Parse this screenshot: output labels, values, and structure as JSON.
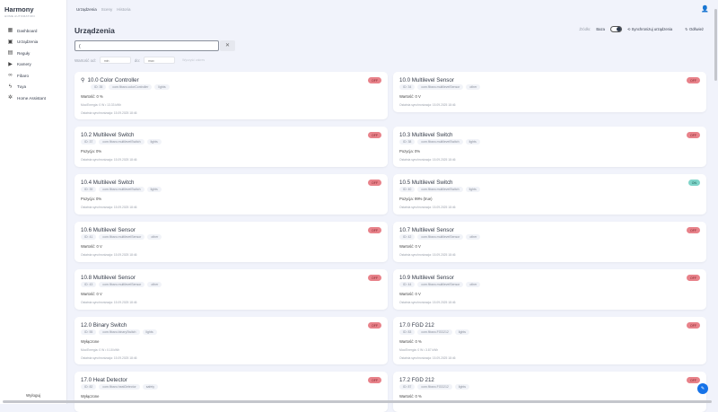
{
  "app": {
    "title": "Harmony",
    "subtitle": "HOME AUTOMATION",
    "logout": "Wyloguj"
  },
  "sidebar": {
    "items": [
      {
        "label": "Dashboard",
        "icon": "▦"
      },
      {
        "label": "Urządzenia",
        "icon": "▣"
      },
      {
        "label": "Reguły",
        "icon": "▤"
      },
      {
        "label": "Kamery",
        "icon": "▶"
      },
      {
        "label": "Fibaro",
        "icon": "∞"
      },
      {
        "label": "Tuya",
        "icon": "ϟ"
      },
      {
        "label": "Home Assistant",
        "icon": "✲"
      }
    ]
  },
  "topnav": {
    "tabs": [
      "Urządzenia",
      "Sceny",
      "Historia"
    ],
    "user_icon": "👤"
  },
  "page": {
    "title": "Urządzenia",
    "search_value": "(",
    "clear": "✕"
  },
  "filter": {
    "from_label": "Wartość od:",
    "min_placeholder": "min",
    "to_label": "do:",
    "max_placeholder": "max",
    "reset": "Wyczyść zakres"
  },
  "toolbar": {
    "source_label": "Źródło:",
    "source_value": "Baza",
    "sync": "Synchronizuj urządzenia",
    "sync_icon": "⟲",
    "refresh": "Odśwież",
    "refresh_icon": "↻"
  },
  "devices": [
    {
      "name": "10.0 Color Controller",
      "id": "ID: 35",
      "type": "com.fibaro.colorController",
      "cat": "lights",
      "value": "Wartość: 0 %",
      "energy": "Moc/Energia: 0 W • 13.33 kWh",
      "sync": "Ostatnia synchronizacja: 15.09.2025 18:46",
      "status": "OFF",
      "icon": true
    },
    {
      "name": "10.0 Multilevel Sensor",
      "id": "ID: 34",
      "type": "com.fibaro.multilevelSensor",
      "cat": "other",
      "value": "Wartość: 0 V",
      "sync": "Ostatnia synchronizacja: 15.09.2025 18:46",
      "status": "OFF"
    },
    {
      "name": "10.2 Multilevel Switch",
      "id": "ID: 37",
      "type": "com.fibaro.multilevelSwitch",
      "cat": "lights",
      "value": "Pozycja: 0%",
      "sync": "Ostatnia synchronizacja: 15.09.2025 18:46",
      "status": "OFF"
    },
    {
      "name": "10.3 Multilevel Switch",
      "id": "ID: 38",
      "type": "com.fibaro.multilevelSwitch",
      "cat": "lights",
      "value": "Pozycja: 0%",
      "sync": "Ostatnia synchronizacja: 15.09.2025 18:46",
      "status": "OFF"
    },
    {
      "name": "10.4 Multilevel Switch",
      "id": "ID: 39",
      "type": "com.fibaro.multilevelSwitch",
      "cat": "lights",
      "value": "Pozycja: 0%",
      "sync": "Ostatnia synchronizacja: 15.09.2025 18:46",
      "status": "OFF"
    },
    {
      "name": "10.5 Multilevel Switch",
      "id": "ID: 40",
      "type": "com.fibaro.multilevelSwitch",
      "cat": "lights",
      "value": "Pozycja: 99% (true)",
      "sync": "Ostatnia synchronizacja: 15.09.2025 18:46",
      "status": "ON"
    },
    {
      "name": "10.6 Multilevel Sensor",
      "id": "ID: 41",
      "type": "com.fibaro.multilevelSensor",
      "cat": "other",
      "value": "Wartość: 0 V",
      "sync": "Ostatnia synchronizacja: 15.09.2025 18:46",
      "status": "OFF"
    },
    {
      "name": "10.7 Multilevel Sensor",
      "id": "ID: 42",
      "type": "com.fibaro.multilevelSensor",
      "cat": "other",
      "value": "Wartość: 0 V",
      "sync": "Ostatnia synchronizacja: 15.09.2025 18:46",
      "status": "OFF"
    },
    {
      "name": "10.8 Multilevel Sensor",
      "id": "ID: 43",
      "type": "com.fibaro.multilevelSensor",
      "cat": "other",
      "value": "Wartość: 0 V",
      "sync": "Ostatnia synchronizacja: 15.09.2025 18:46",
      "status": "OFF"
    },
    {
      "name": "10.9 Multilevel Sensor",
      "id": "ID: 44",
      "type": "com.fibaro.multilevelSensor",
      "cat": "other",
      "value": "Wartość: 0 V",
      "sync": "Ostatnia synchronizacja: 15.09.2025 18:46",
      "status": "OFF"
    },
    {
      "name": "12.0 Binary Switch",
      "id": "ID: 55",
      "type": "com.fibaro.binarySwitch",
      "cat": "lights",
      "value": "Wyłączone",
      "energy": "Moc/Energia: 0 W • 0.18 kWh",
      "sync": "Ostatnia synchronizacja: 15.09.2025 18:46",
      "status": "OFF"
    },
    {
      "name": "17.0 FGD 212",
      "id": "ID: 83",
      "type": "com.fibaro.FGD212",
      "cat": "lights",
      "value": "Wartość: 0 %",
      "energy": "Moc/Energia: 0 W • 3.87 kWh",
      "sync": "Ostatnia synchronizacja: 15.09.2025 18:46",
      "status": "OFF"
    },
    {
      "name": "17.0 Heat Detector",
      "id": "ID: 82",
      "type": "com.fibaro.heatDetector",
      "cat": "safety",
      "value": "Wyłączone",
      "status": "OFF"
    },
    {
      "name": "17.2 FGD 212",
      "id": "ID: 87",
      "type": "com.fibaro.FGD212",
      "cat": "lights",
      "value": "Wartość: 0 %",
      "status": "OFF"
    }
  ],
  "fab_icon": "✎"
}
